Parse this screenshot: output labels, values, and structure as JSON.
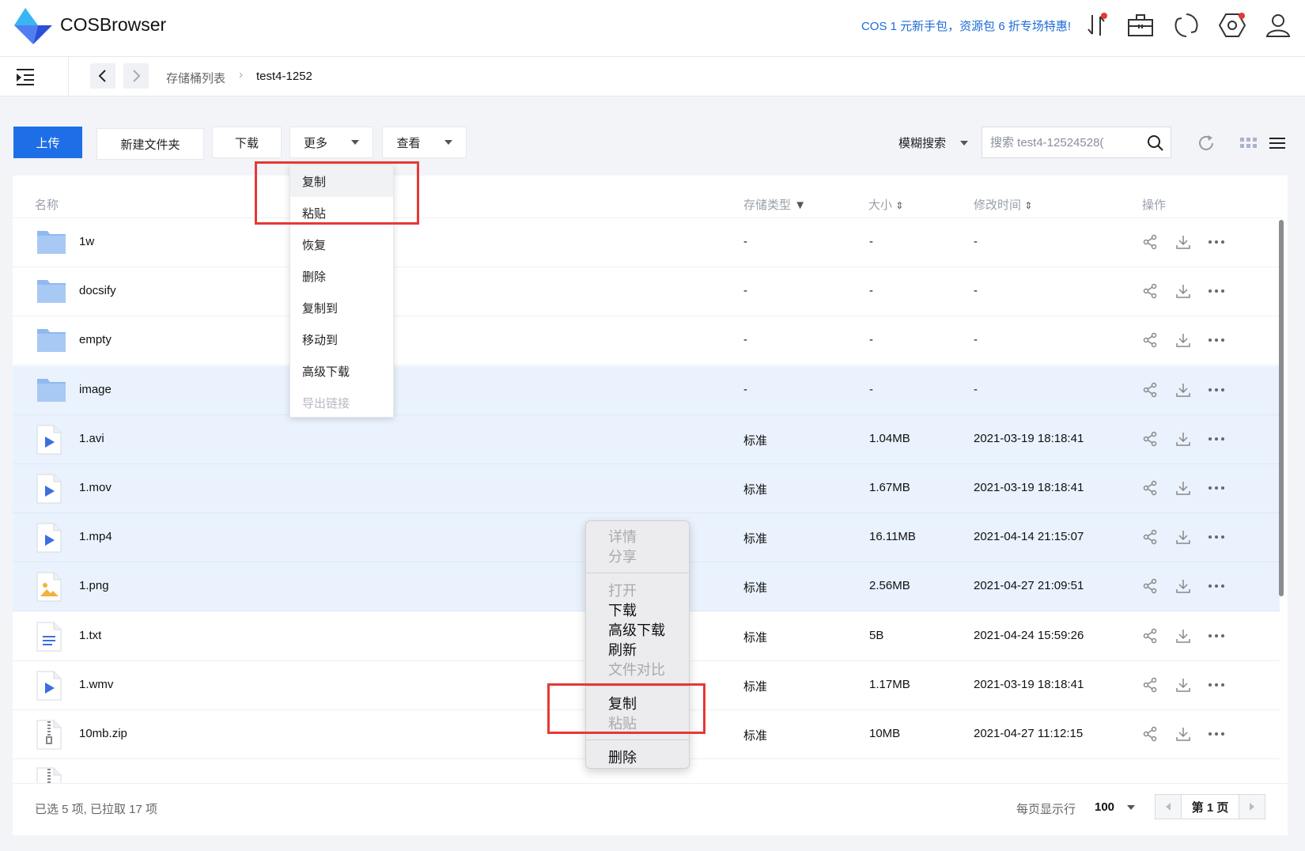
{
  "app": {
    "title": "COSBrowser",
    "promo": "COS 1 元新手包，资源包 6 折专场特惠!"
  },
  "colors": {
    "accent": "#1e6ee8",
    "highlight_border": "#e53935",
    "selected_row": "#eaf2fd"
  },
  "breadcrumb": {
    "root": "存储桶列表",
    "current": "test4-1252"
  },
  "toolbar": {
    "upload": "上传",
    "new_folder": "新建文件夹",
    "download": "下载",
    "more": "更多",
    "view": "查看",
    "search_mode": "模糊搜索",
    "search_value": "搜索 test4-12524528("
  },
  "table": {
    "headers": {
      "name": "名称",
      "storage": "存储类型",
      "size": "大小",
      "modified": "修改时间",
      "ops": "操作"
    },
    "rows": [
      {
        "name": "1w",
        "type": "folder",
        "storage": "-",
        "size": "-",
        "modified": "-"
      },
      {
        "name": "docsify",
        "type": "folder",
        "storage": "-",
        "size": "-",
        "modified": "-"
      },
      {
        "name": "empty",
        "type": "folder",
        "storage": "-",
        "size": "-",
        "modified": "-"
      },
      {
        "name": "image",
        "type": "folder",
        "storage": "-",
        "size": "-",
        "modified": "-"
      },
      {
        "name": "1.avi",
        "type": "video",
        "storage": "标准",
        "size": "1.04MB",
        "modified": "2021-03-19 18:18:41"
      },
      {
        "name": "1.mov",
        "type": "video",
        "storage": "标准",
        "size": "1.67MB",
        "modified": "2021-03-19 18:18:41"
      },
      {
        "name": "1.mp4",
        "type": "video",
        "storage": "标准",
        "size": "16.11MB",
        "modified": "2021-04-14 21:15:07"
      },
      {
        "name": "1.png",
        "type": "image",
        "storage": "标准",
        "size": "2.56MB",
        "modified": "2021-04-27 21:09:51"
      },
      {
        "name": "1.txt",
        "type": "text",
        "storage": "标准",
        "size": "5B",
        "modified": "2021-04-24 15:59:26"
      },
      {
        "name": "1.wmv",
        "type": "video",
        "storage": "标准",
        "size": "1.17MB",
        "modified": "2021-03-19 18:18:41"
      },
      {
        "name": "10mb.zip",
        "type": "zip",
        "storage": "标准",
        "size": "10MB",
        "modified": "2021-04-27 11:12:15"
      }
    ]
  },
  "dropdown": {
    "items": [
      {
        "label": "复制"
      },
      {
        "label": "粘贴"
      },
      {
        "label": "恢复"
      },
      {
        "label": "删除"
      },
      {
        "label": "复制到"
      },
      {
        "label": "移动到"
      },
      {
        "label": "高级下载"
      },
      {
        "label": "导出链接"
      }
    ]
  },
  "context_menu": {
    "group1": [
      "详情",
      "分享"
    ],
    "group2": [
      "打开",
      "下载",
      "高级下载",
      "刷新",
      "文件对比"
    ],
    "group3": [
      "复制",
      "粘贴"
    ],
    "group4": [
      "删除"
    ]
  },
  "footer": {
    "status": "已选 5 项, 已拉取 17 项",
    "per_page_label": "每页显示行",
    "per_page": "100",
    "page": "第 1 页"
  }
}
